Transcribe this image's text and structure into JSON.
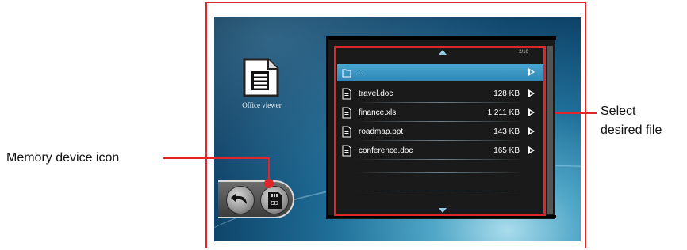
{
  "app": {
    "label": "Office viewer",
    "icon": "document-icon"
  },
  "file_list": {
    "page_indicator": "2/10",
    "scroll_up_icon": "up-arrow-icon",
    "scroll_down_icon": "down-arrow-icon",
    "folder_row": {
      "name": "..",
      "icon": "folder-icon"
    },
    "files": [
      {
        "name": "travel.doc",
        "size": "128 KB"
      },
      {
        "name": "finance.xls",
        "size": "1,211 KB"
      },
      {
        "name": "roadmap.ppt",
        "size": "143 KB"
      },
      {
        "name": "conference.doc",
        "size": "165 KB"
      }
    ]
  },
  "controls": {
    "back_icon": "back-arrow-icon",
    "memory_device_label": "SD"
  },
  "annotations": {
    "memory_device": "Memory device icon",
    "select_line1": "Select",
    "select_line2": "desired file"
  },
  "colors": {
    "callout": "#e0252b",
    "selection_bar": "#3a93c2",
    "panel": "#1a1a1a"
  }
}
